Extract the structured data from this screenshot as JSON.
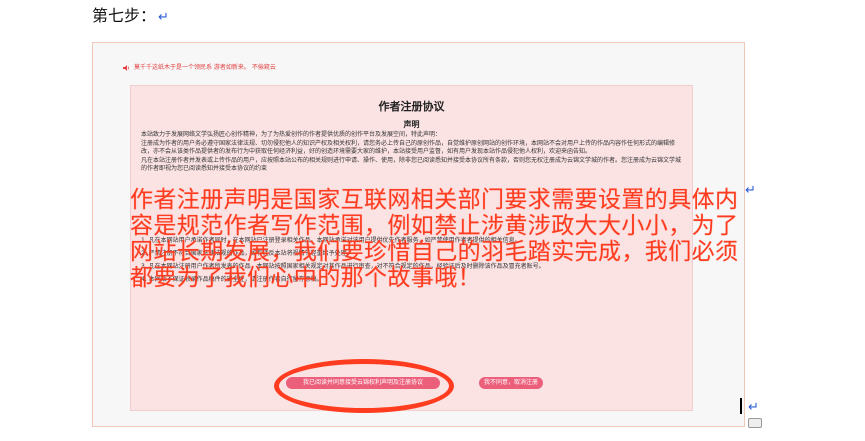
{
  "step": {
    "title": "第七步：",
    "mark": "↵"
  },
  "notice": {
    "text": "莫千千这纸木于是一个领民系 游者如新来。 不偷窥云"
  },
  "agreement": {
    "title": "作者注册协议",
    "subtitle": "声明",
    "body": [
      "本站致力于发展网络文学弘扬匠心创作精神，为了为热爱创作的作者提供优质的创作平台及发展空间，特此声明：",
      "注册成为作者的用户务必遵守国家法律法规、切勿侵犯他人的知识产权及相关权利，请您务必上传自己的原创作品，自觉维护原创网站的创作环境，本网站不会对用户上传的作品内容作任何形式的编辑修改，亦不会从该类作品提供者的发布行为中获取任何经济利益，好的创造环境需要大家的维护，本站接受用户监督，如有用户发现本站作品侵犯他人权利，欢迎来函告知。",
      "凡在本站注册作者并发表或上传作品的用户，应按照本站公布的相关规则进行申请、操作、使用，除非您已阅读悉知并接受本协议所有条款，否则您无权注册成为云锦文学城的作者。您注册成为云锦文学城的作者即视为您已阅读悉知并接受本协议的约束"
    ],
    "rules": [
      "1. 凡在本网站用户承诺作者同时，在本网站已注册登录相关作品，本网站承诺对该用户提供优先作者服务，如严禁使用作者者提供的相关信息。",
      "2. 严禁注册不符合国家法律法规的作品，如有违反本站将视情节轻重给予处理。",
      "3. 凡在本网站注册用户作者所发表的作品，本网站按照国家相关规定对其作品进行审查，对不符合规定的作品，经验证后及时删除该作品及冒充者账号。",
      "4. 本网站不保证收录作品稿件的安全性，请注册作者自行留存原稿。"
    ],
    "agree_label": "我已阅读并同意接受云锦权利声明及注册协议",
    "disagree_label": "我不同意，取消注册"
  },
  "overlay": {
    "text": "作者注册声明是国家互联网相关部门要求需要设置的具体内容是规范作者写作范围，例如禁止涉黄涉政大大小小，为了网站长期发展，我们要珍惜自己的羽毛踏实完成，我们必须都要为了我们心中的那个故事哦！"
  },
  "colors": {
    "overlay_red": "#ff3c1f",
    "button_pink": "#ec5f7b",
    "box_pink": "#fbe3e4",
    "para_mark_blue": "#2a5bd7"
  },
  "icons": [
    "speaker-icon",
    "paragraph-mark-icon",
    "text-cursor-icon"
  ]
}
